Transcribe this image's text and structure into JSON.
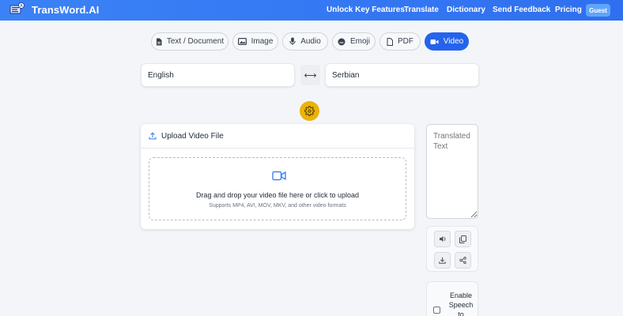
{
  "brand": {
    "name": "TransWord.AI"
  },
  "nav": {
    "unlock": "Unlock Key Features",
    "translate": "Translate",
    "dictionary": "Dictionary",
    "feedback": "Send Feedback",
    "pricing": "Pricing",
    "guest": "Guest"
  },
  "tabs": [
    {
      "label": "Text / Document",
      "icon": "document-icon"
    },
    {
      "label": "Image",
      "icon": "image-icon"
    },
    {
      "label": "Audio",
      "icon": "microphone-icon"
    },
    {
      "label": "Emoji",
      "icon": "emoji-icon"
    },
    {
      "label": "PDF",
      "icon": "pdf-icon"
    },
    {
      "label": "Video",
      "icon": "video-icon",
      "active": true
    }
  ],
  "languages": {
    "source": "English",
    "swap": "⟷",
    "target": "Serbian"
  },
  "upload": {
    "header": "Upload Video File",
    "dropzone_title": "Drag and drop your video file here or click to upload",
    "dropzone_subtitle": "Supports MP4, AVI, MOV, MKV, and other video formats"
  },
  "output": {
    "placeholder": "Translated Text"
  },
  "speech": {
    "label": "Enable Speech to",
    "checked": false
  },
  "colors": {
    "primary": "#2563eb",
    "navbar": "#3b82f6",
    "settings": "#eab308"
  }
}
